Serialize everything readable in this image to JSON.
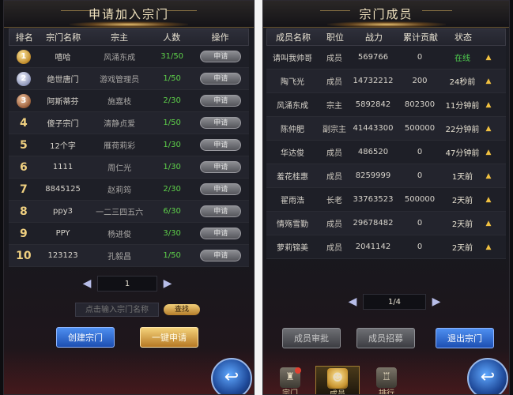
{
  "left_panel": {
    "title": "申请加入宗门",
    "headers": [
      "排名",
      "宗门名称",
      "宗主",
      "人数",
      "操作"
    ],
    "rows": [
      {
        "rank": "1",
        "name": "嘻哈",
        "leader": "风涌东成",
        "count": "31/50",
        "action": "申请"
      },
      {
        "rank": "2",
        "name": "绝世唐门",
        "leader": "游戏管理员",
        "count": "1/50",
        "action": "申请"
      },
      {
        "rank": "3",
        "name": "阿斯蒂芬",
        "leader": "施嘉枝",
        "count": "2/30",
        "action": "申请"
      },
      {
        "rank": "4",
        "name": "傻子宗门",
        "leader": "清静贞爱",
        "count": "1/50",
        "action": "申请"
      },
      {
        "rank": "5",
        "name": "12个字",
        "leader": "雁荷莉彩",
        "count": "1/30",
        "action": "申请"
      },
      {
        "rank": "6",
        "name": "1111",
        "leader": "周仁光",
        "count": "1/30",
        "action": "申请"
      },
      {
        "rank": "7",
        "name": "8845125",
        "leader": "赵莉筠",
        "count": "2/30",
        "action": "申请"
      },
      {
        "rank": "8",
        "name": "ppy3",
        "leader": "一二三四五六",
        "count": "6/30",
        "action": "申请"
      },
      {
        "rank": "9",
        "name": "PPY",
        "leader": "杨进俊",
        "count": "3/30",
        "action": "申请"
      },
      {
        "rank": "10",
        "name": "123123",
        "leader": "孔毅昌",
        "count": "1/50",
        "action": "申请"
      }
    ],
    "page": "1",
    "search_placeholder": "点击输入宗门名称",
    "search_button": "查找",
    "create_button": "创建宗门",
    "quick_apply_button": "一键申请"
  },
  "right_panel": {
    "title": "宗门成员",
    "headers": [
      "成员名称",
      "职位",
      "战力",
      "累计贡献",
      "状态"
    ],
    "rows": [
      {
        "name": "请叫我帅哥",
        "role": "成员",
        "power": "569766",
        "contrib": "0",
        "status": "在线"
      },
      {
        "name": "陶飞光",
        "role": "成员",
        "power": "14732212",
        "contrib": "200",
        "status": "24秒前"
      },
      {
        "name": "风涌东成",
        "role": "宗主",
        "power": "5892842",
        "contrib": "802300",
        "status": "11分钟前"
      },
      {
        "name": "陈仲肥",
        "role": "副宗主",
        "power": "41443300",
        "contrib": "500000",
        "status": "22分钟前"
      },
      {
        "name": "华达俊",
        "role": "成员",
        "power": "486520",
        "contrib": "0",
        "status": "47分钟前"
      },
      {
        "name": "羞花桂惠",
        "role": "成员",
        "power": "8259999",
        "contrib": "0",
        "status": "1天前"
      },
      {
        "name": "翟雨浩",
        "role": "长老",
        "power": "33763523",
        "contrib": "500000",
        "status": "2天前"
      },
      {
        "name": "情殇雪勤",
        "role": "成员",
        "power": "29678482",
        "contrib": "0",
        "status": "2天前"
      },
      {
        "name": "萝莉锦美",
        "role": "成员",
        "power": "2041142",
        "contrib": "0",
        "status": "2天前"
      }
    ],
    "page": "1/4",
    "review_button": "成员审批",
    "recruit_button": "成员招募",
    "leave_button": "退出宗门",
    "tabs": [
      "宗门",
      "成员",
      "排行"
    ]
  },
  "colors": {
    "online": "#4fd04f",
    "count": "#5ed04a",
    "accent_gold": "#f0c040",
    "button_blue": "#1d4fb2"
  }
}
